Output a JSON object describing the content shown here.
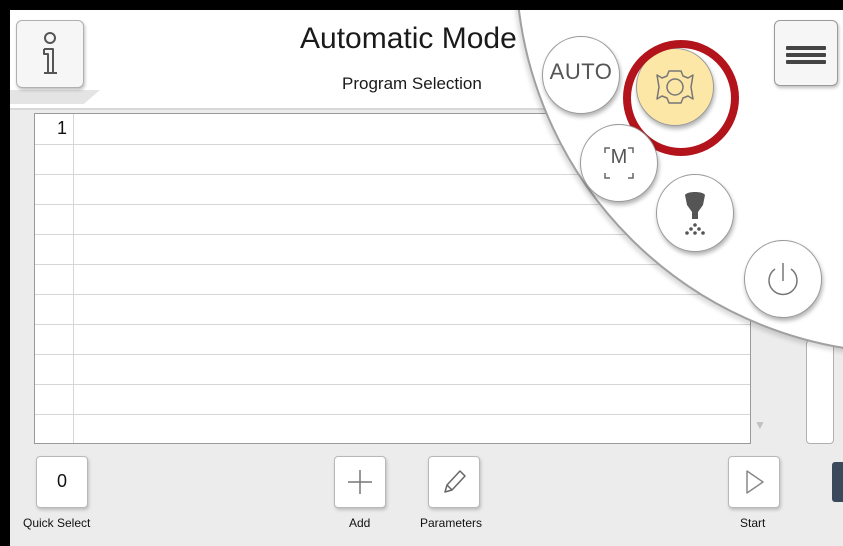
{
  "header": {
    "title": "Automatic Mode",
    "subtitle": "Program Selection"
  },
  "table": {
    "rows": [
      "1",
      "",
      "",
      "",
      "",
      "",
      "",
      "",
      "",
      "",
      ""
    ]
  },
  "footer": {
    "quick_select_value": "0",
    "quick_select_label": "Quick Select",
    "add_label": "Add",
    "parameters_label": "Parameters",
    "start_label": "Start"
  },
  "radial_menu": {
    "auto_label": "AUTO",
    "manual_label": "M"
  },
  "colors": {
    "highlight": "#b3131b",
    "settings_active": "#fde7a6"
  },
  "icons": [
    "info-icon",
    "menu-icon",
    "settings-gear-icon",
    "power-icon",
    "plus-icon",
    "pencil-icon",
    "play-icon",
    "dispenser-icon"
  ]
}
